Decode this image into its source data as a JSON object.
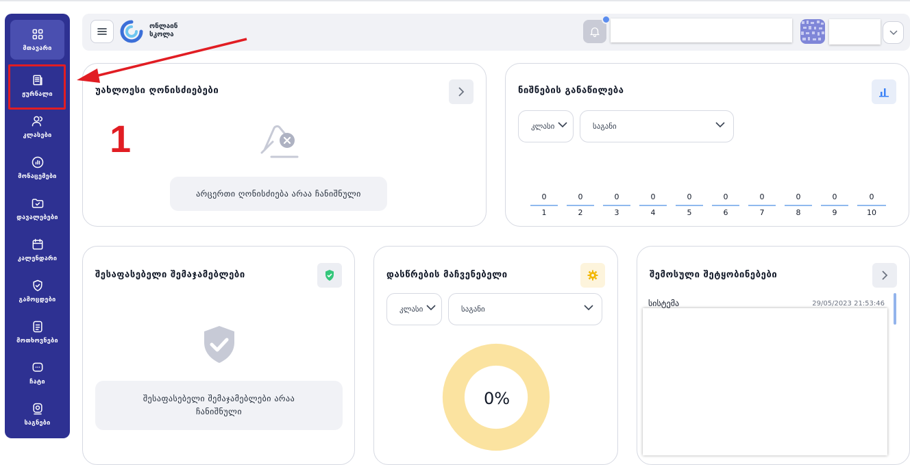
{
  "sidebar": {
    "items": [
      {
        "label": "მთავარი",
        "icon": "grid-icon"
      },
      {
        "label": "ჟურნალი",
        "icon": "journal-icon"
      },
      {
        "label": "კლასები",
        "icon": "users-icon"
      },
      {
        "label": "მონაცემები",
        "icon": "chart-icon"
      },
      {
        "label": "დავალებები",
        "icon": "folder-check-icon"
      },
      {
        "label": "კალენდარი",
        "icon": "calendar-icon"
      },
      {
        "label": "გამოცდები",
        "icon": "shield-check-icon"
      },
      {
        "label": "მოთხოვნები",
        "icon": "document-icon"
      },
      {
        "label": "ჩატი",
        "icon": "chat-icon"
      },
      {
        "label": "საგნები",
        "icon": "book-icon"
      }
    ]
  },
  "header": {
    "logo_line1": "ონლაინ",
    "logo_line2": "სკოლა"
  },
  "upcoming_events": {
    "title": "უახლოესი ღონისძიებები",
    "empty_text": "არცერთი ღონისძიება არაა ჩანიშნული"
  },
  "grade_distribution": {
    "title": "ნიშნების განაწილება",
    "class_select": "კლასი",
    "subject_select": "საგანი",
    "grades": [
      {
        "grade": "1",
        "count": "0"
      },
      {
        "grade": "2",
        "count": "0"
      },
      {
        "grade": "3",
        "count": "0"
      },
      {
        "grade": "4",
        "count": "0"
      },
      {
        "grade": "5",
        "count": "0"
      },
      {
        "grade": "6",
        "count": "0"
      },
      {
        "grade": "7",
        "count": "0"
      },
      {
        "grade": "8",
        "count": "0"
      },
      {
        "grade": "9",
        "count": "0"
      },
      {
        "grade": "10",
        "count": "0"
      }
    ]
  },
  "assessments": {
    "title": "შესაფასებელი შემაჯამებლები",
    "empty_text": "შესაფასებელი შემაჯამებლები არაა ჩანიშნული"
  },
  "attendance": {
    "title": "დასწრების მაჩვენებელი",
    "class_select": "კლასი",
    "subject_select": "საგანი",
    "percent_label": "0%",
    "percent_value": 0
  },
  "messages": {
    "title": "შემოსული შეტყობინებები",
    "items": [
      {
        "sender": "სისტემა",
        "date": "29/05/2023 21:53:46"
      }
    ]
  },
  "annotation": {
    "step": "1"
  },
  "colors": {
    "sidebar": "#2e3192",
    "accent_red": "#e11d23",
    "donut": "#fbe3a0",
    "shield_green": "#34c77b",
    "gear_yellow": "#f2b705"
  }
}
